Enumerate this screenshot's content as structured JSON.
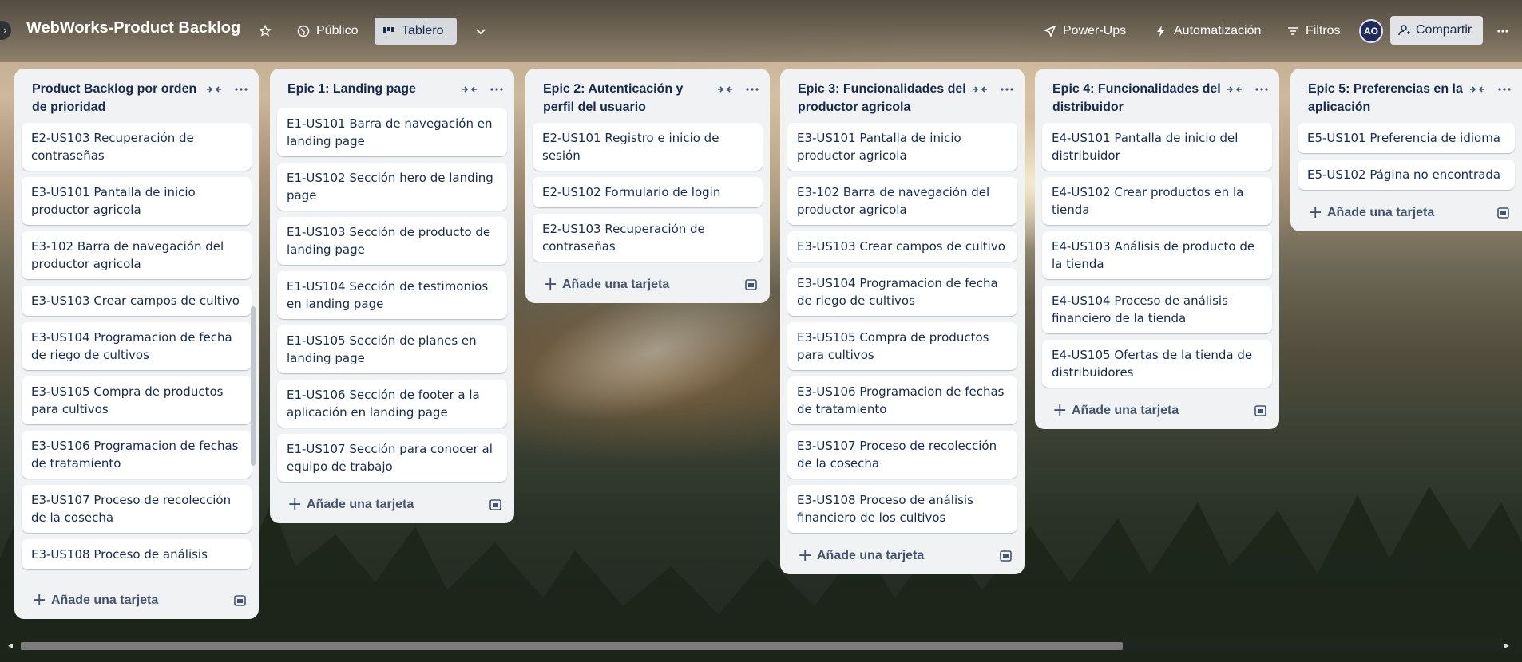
{
  "header": {
    "board_title": "WebWorks-Product Backlog",
    "visibility_label": "Público",
    "view_label": "Tablero",
    "powerups_label": "Power-Ups",
    "automation_label": "Automatización",
    "filters_label": "Filtros",
    "avatar_initials": "AO",
    "share_label": "Compartir"
  },
  "add_card_label": "Añade una tarjeta",
  "lists": [
    {
      "title": "Product Backlog por orden de prioridad",
      "cards": [
        "E2-US103 Recuperación de contraseñas",
        "E3-US101 Pantalla de inicio productor agricola",
        "E3-102 Barra de navegación del productor agricola",
        "E3-US103 Crear campos de cultivo",
        "E3-US104 Programacion de fecha de riego de cultivos",
        "E3-US105 Compra de productos para cultivos",
        "E3-US106 Programacion de fechas de tratamiento",
        "E3-US107 Proceso de recolección de la cosecha",
        "E3-US108 Proceso de análisis"
      ]
    },
    {
      "title": "Epic 1: Landing page",
      "cards": [
        "E1-US101 Barra de navegación en landing page",
        "E1-US102 Sección hero de landing page",
        "E1-US103 Sección de producto de landing page",
        "E1-US104 Sección de testimonios en landing page",
        "E1-US105 Sección de planes en landing page",
        "E1-US106 Sección de footer a la aplicación en landing page",
        "E1-US107 Sección para conocer al equipo de trabajo"
      ]
    },
    {
      "title": "Epic 2: Autenticación y perfil del usuario",
      "cards": [
        "E2-US101 Registro e inicio de sesión",
        "E2-US102 Formulario de login",
        "E2-US103 Recuperación de contraseñas"
      ]
    },
    {
      "title": "Epic 3: Funcionalidades del productor agricola",
      "cards": [
        "E3-US101 Pantalla de inicio productor agricola",
        "E3-102 Barra de navegación del productor agricola",
        "E3-US103 Crear campos de cultivo",
        "E3-US104 Programacion de fecha de riego de cultivos",
        "E3-US105 Compra de productos para cultivos",
        "E3-US106 Programacion de fechas de tratamiento",
        "E3-US107 Proceso de recolección de la cosecha",
        "E3-US108 Proceso de análisis financiero de los cultivos"
      ]
    },
    {
      "title": "Epic 4: Funcionalidades del distribuidor",
      "cards": [
        "E4-US101 Pantalla de inicio del distribuidor",
        "E4-US102 Crear productos en la tienda",
        "E4-US103 Análisis de producto de la tienda",
        "E4-US104 Proceso de análisis financiero de la tienda",
        "E4-US105 Ofertas de la tienda de distribuidores"
      ]
    },
    {
      "title": "Epic 5: Preferencias en la aplicación",
      "cards": [
        "E5-US101 Preferencia de idioma",
        "E5-US102 Página no encontrada"
      ]
    }
  ]
}
